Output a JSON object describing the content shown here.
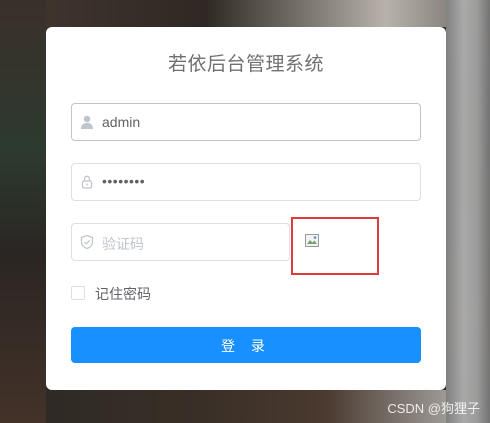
{
  "app": {
    "title": "若依后台管理系统"
  },
  "login_form": {
    "username": {
      "value": "admin",
      "icon": "user-icon"
    },
    "password": {
      "masked_value": "••••••••",
      "icon": "lock-icon"
    },
    "captcha": {
      "placeholder": "验证码",
      "icon": "shield-icon",
      "image_icon": "broken-image-icon"
    },
    "remember_label": "记住密码",
    "submit_label": "登 录"
  },
  "watermark": "CSDN @狗狸子",
  "colors": {
    "primary": "#1890ff",
    "highlight_border": "#e03a3a"
  }
}
